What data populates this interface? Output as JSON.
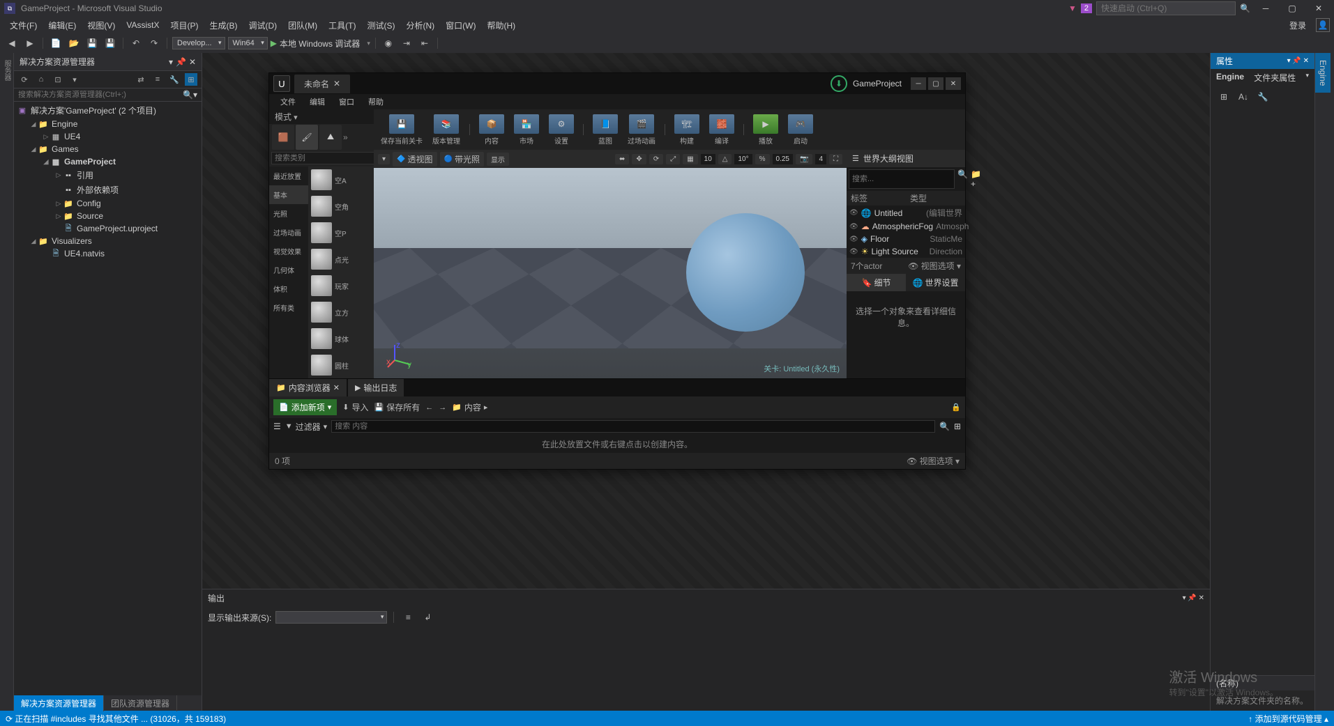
{
  "title_bar": {
    "title": "GameProject - Microsoft Visual Studio",
    "flag_count": "2",
    "quick_launch_placeholder": "快速启动 (Ctrl+Q)"
  },
  "menu": {
    "items": [
      "文件(F)",
      "编辑(E)",
      "视图(V)",
      "VAssistX",
      "项目(P)",
      "生成(B)",
      "调试(D)",
      "团队(M)",
      "工具(T)",
      "测试(S)",
      "分析(N)",
      "窗口(W)",
      "帮助(H)"
    ],
    "login": "登录"
  },
  "toolbar": {
    "config": "Develop...",
    "platform": "Win64",
    "debugger": "本地 Windows 调试器"
  },
  "solution_explorer": {
    "title": "解决方案资源管理器",
    "search_placeholder": "搜索解决方案资源管理器(Ctrl+;)",
    "root": "解决方案'GameProject' (2 个项目)",
    "engine": "Engine",
    "ue4": "UE4",
    "games": "Games",
    "gameproject": "GameProject",
    "refs": "引用",
    "external": "外部依赖项",
    "config": "Config",
    "source": "Source",
    "uproject": "GameProject.uproject",
    "visualizers": "Visualizers",
    "natvis": "UE4.natvis"
  },
  "panel_tabs": {
    "sol": "解决方案资源管理器",
    "team": "团队资源管理器"
  },
  "output": {
    "title": "输出",
    "show_from": "显示输出来源(S):"
  },
  "properties": {
    "title": "属性",
    "sub_a": "Engine",
    "sub_b": "文件夹属性",
    "side_tab": "Engine",
    "grid_head": "(名称)",
    "grid_desc": "解决方案文件夹的名称。"
  },
  "status": {
    "left": "⟳  正在扫描  #includes  寻找其他文件 ... (31026，共 159183)",
    "right": "↑  添加到源代码管理 ▴"
  },
  "unreal": {
    "tab_title": "未命名",
    "project": "GameProject",
    "menu": [
      "文件",
      "编辑",
      "窗口",
      "帮助"
    ],
    "modes_label": "模式",
    "tb": [
      "保存当前关卡",
      "版本管理",
      "内容",
      "市场",
      "设置",
      "蓝图",
      "过场动画",
      "构建",
      "编译",
      "播放",
      "启动"
    ],
    "left_search": "搜索类别",
    "cats": [
      "最近放置",
      "基本",
      "光照",
      "过场动画",
      "视觉效果",
      "几何体",
      "体积",
      "所有类"
    ],
    "assets": [
      "空A",
      "空角",
      "空P",
      "点光",
      "玩家",
      "立方",
      "球体",
      "圆柱"
    ],
    "vp": {
      "persp": "透视图",
      "lit": "带光照",
      "show": "显示",
      "snap_t": "10",
      "snap_r": "10°",
      "snap_s": "0.25",
      "cam": "4",
      "level_label": "关卡: Untitled (永久性)"
    },
    "outliner": {
      "title": "世界大纲视图",
      "search": "搜索...",
      "col_a": "标签",
      "col_b": "类型",
      "rows": [
        [
          "Untitled",
          "(编辑世界"
        ],
        [
          "AtmosphericFog",
          "Atmosph"
        ],
        [
          "Floor",
          "StaticMe"
        ],
        [
          "Light Source",
          "Direction"
        ]
      ],
      "footer_left": "7个actor",
      "footer_right": "视图选项 ▾"
    },
    "details": {
      "tab_a": "细节",
      "tab_b": "世界设置",
      "placeholder": "选择一个对象来查看详细信息。"
    },
    "cb": {
      "tab_a": "内容浏览器",
      "tab_b": "输出日志",
      "add": "添加新项",
      "import": "导入",
      "saveall": "保存所有",
      "path": "内容",
      "filter_ph": "搜索 内容",
      "filter_label": "过滤器",
      "empty": "在此处放置文件或右键点击以创建内容。",
      "items": "0 项",
      "view": "视图选项 ▾"
    }
  },
  "watermark": {
    "big": "激活 Windows",
    "small": "转到\"设置\"以激活 Windows。"
  }
}
